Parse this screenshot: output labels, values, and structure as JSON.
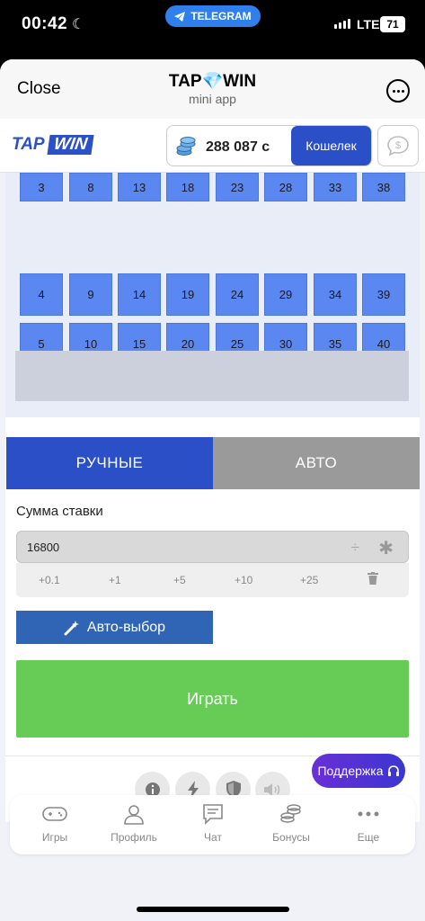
{
  "status_bar": {
    "time": "00:42",
    "telegram_label": "TELEGRAM",
    "network": "LTE",
    "battery": "71"
  },
  "mini_app_bar": {
    "close_label": "Close",
    "title": "TAP💎WIN",
    "subtitle": "mini app"
  },
  "header": {
    "logo_tap": "TAP",
    "logo_win": "WIN",
    "balance": "288 087 с",
    "wallet_label": "Кошелек"
  },
  "grid": {
    "rows": [
      [
        "3",
        "8",
        "13",
        "18",
        "23",
        "28",
        "33",
        "38"
      ],
      [
        "4",
        "9",
        "14",
        "19",
        "24",
        "29",
        "34",
        "39"
      ],
      [
        "5",
        "10",
        "15",
        "20",
        "25",
        "30",
        "35",
        "40"
      ]
    ]
  },
  "tabs": {
    "manual": "РУЧНЫЕ",
    "auto": "АВТО"
  },
  "bet": {
    "label": "Сумма ставки",
    "value": "16800",
    "divide_symbol": "÷",
    "multiply_symbol": "✱",
    "quick": [
      "+0.1",
      "+1",
      "+5",
      "+10",
      "+25"
    ]
  },
  "auto_pick_label": "Авто-выбор",
  "play_label": "Играть",
  "support_label": "Поддержка",
  "nav": [
    {
      "label": "Игры",
      "icon": "gamepad-icon"
    },
    {
      "label": "Профиль",
      "icon": "user-icon"
    },
    {
      "label": "Чат",
      "icon": "chat-icon"
    },
    {
      "label": "Бонусы",
      "icon": "coins-icon"
    },
    {
      "label": "Еще",
      "icon": "more-icon"
    }
  ],
  "colors": {
    "primary": "#2a4fc7",
    "cell": "#5b87f0",
    "play": "#66cc55",
    "inactive_tab": "#9a9a9a"
  }
}
